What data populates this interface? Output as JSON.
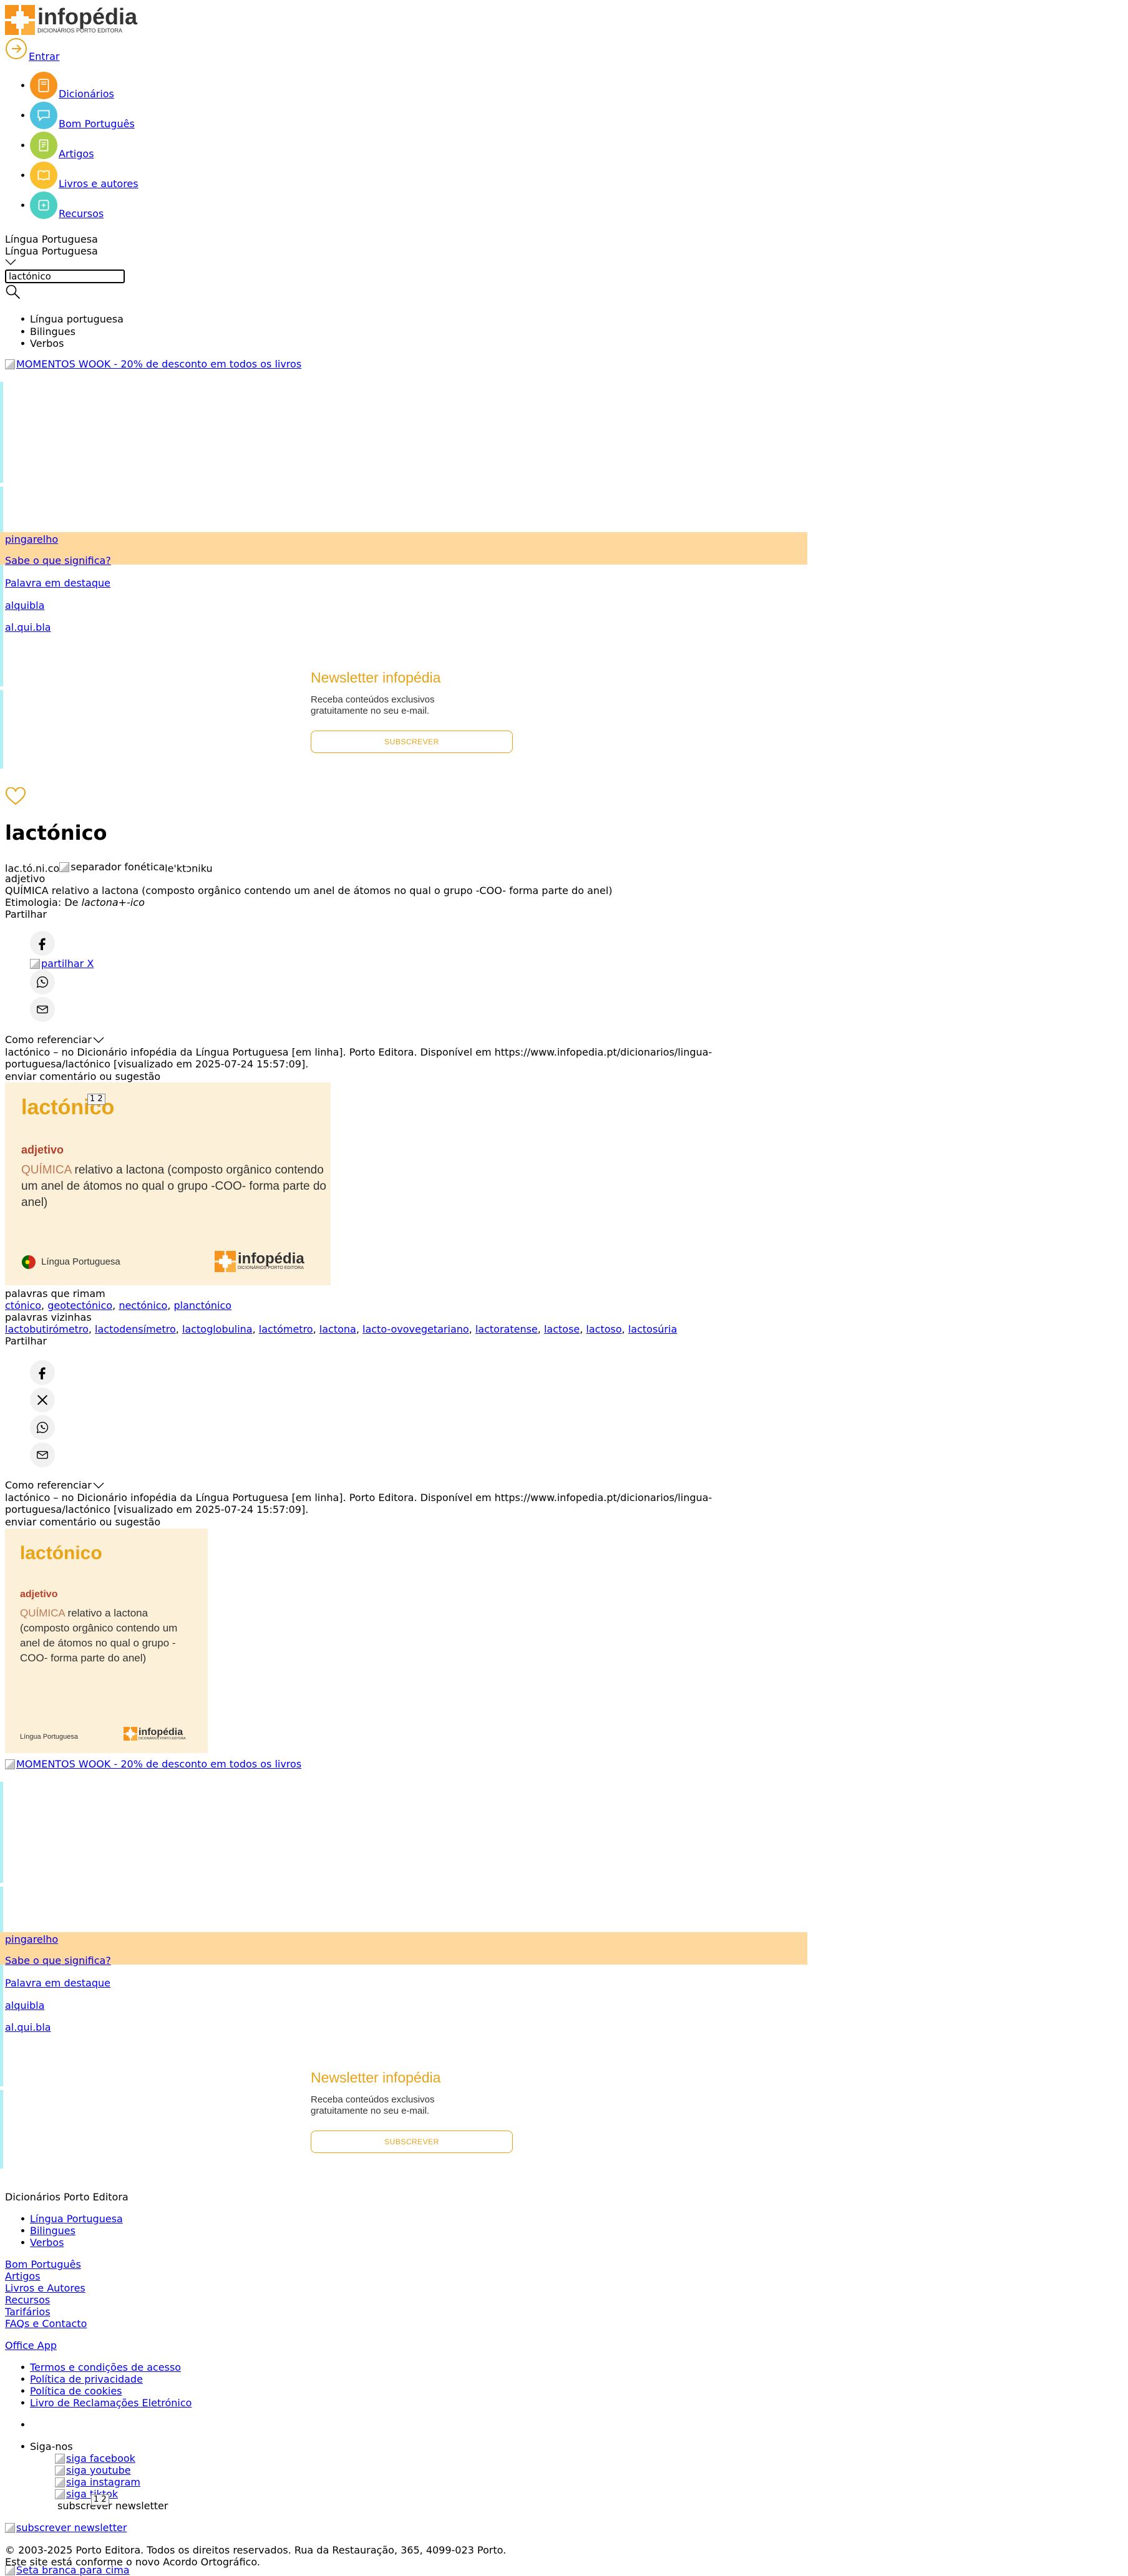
{
  "header": {
    "logo_text": "infopédia",
    "logo_subtext": "DICIONÁRIOS PORTO EDITORA",
    "login_label": "Entrar"
  },
  "nav": {
    "items": [
      {
        "label": "Dicionários",
        "color": "#f7941d"
      },
      {
        "label": "Bom Português",
        "color": "#4ec3e0"
      },
      {
        "label": "Artigos",
        "color": "#a9cf46"
      },
      {
        "label": "Livros e autores",
        "color": "#fbc02d"
      },
      {
        "label": "Recursos",
        "color": "#4dd0c4"
      }
    ]
  },
  "search": {
    "dictionary_selected": "Língua Portuguesa",
    "dictionary_selected_repeat": "Língua Portuguesa",
    "query": "lactónico",
    "options": [
      "Língua portuguesa",
      "Bilingues",
      "Verbos"
    ]
  },
  "ad": {
    "alt": "MOMENTOS WOOK - 20% de desconto em todos os livros"
  },
  "sidebar": {
    "featured_word": "pingarelho",
    "sabe_label": "Sabe o que significa?",
    "destaque_label": "Palavra em destaque",
    "destaque_word": "alquibla",
    "destaque_syllables": "al.qui.bla"
  },
  "newsletter": {
    "title": "Newsletter infopédia",
    "line1": "Receba conteúdos exclusivos",
    "line2": "gratuitamente no seu e-mail.",
    "button": "SUBSCREVER"
  },
  "entry": {
    "word": "lactónico",
    "syllables": "lac.tó.ni.co",
    "separator_alt": "separador fonética",
    "phonetic": "le'ktɔniku",
    "pos": "adjetivo",
    "domain": "QUÍMICA",
    "definition": "relativo a lactona (composto orgânico contendo um anel de átomos no qual o grupo -COO- forma parte do anel)",
    "etym_label": "Etimologia: De",
    "etym_word": "lactona",
    "etym_suffix": "+-ico",
    "share_label": "Partilhar",
    "share_x_alt": "partilhar X",
    "cite_label": "Como referenciar",
    "citation": "lactónico – no Dicionário infopédia da Língua Portuguesa [em linha]. Porto Editora. Disponível em https://www.infopedia.pt/dicionarios/lingua-portuguesa/lactónico [visualizado em 2025-07-24 15:57:09].",
    "comment_label": "enviar comentário ou sugestão"
  },
  "card": {
    "word": "lactónico",
    "pos": "adjetivo",
    "domain": "QUÍMICA",
    "definition": "relativo a lactona (composto orgânico contendo um anel de átomos no qual o grupo -COO- forma parte do anel)",
    "language": "Língua Portuguesa",
    "brand": "infopédia",
    "brand_sub": "DICIONÁRIOS PORTO EDITORA",
    "pager": "1 2"
  },
  "rimam": {
    "label": "palavras que rimam",
    "words": [
      "ctónico",
      "geotectónico",
      "nectónico",
      "planctónico"
    ]
  },
  "vizinhas": {
    "label": "palavras vizinhas",
    "words": [
      "lactobutirómetro",
      "lactodensímetro",
      "lactoglobulina",
      "lactómetro",
      "lactona",
      "lacto-ovovegetariano",
      "lactoratense",
      "lactose",
      "lactoso",
      "lactosúria"
    ]
  },
  "footer": {
    "title": "Dicionários Porto Editora",
    "dict_links": [
      "Língua Portuguesa",
      "Bilingues",
      "Verbos"
    ],
    "main_links": [
      "Bom Português",
      "Artigos",
      "Livros e Autores",
      "Recursos",
      "Tarifários",
      "FAQs e Contacto"
    ],
    "office_app": "Office App",
    "legal_links": [
      "Termos e condições de acesso",
      "Política de privacidade",
      "Política de cookies",
      "Livro de Reclamações Eletrónico"
    ],
    "follow_label": "Siga-nos",
    "social": [
      "siga facebook",
      "siga youtube",
      "siga instagram",
      "siga tiktok"
    ],
    "newsletter_item": "subscrever newsletter",
    "pager": "1 2",
    "newsletter_link": "subscrever newsletter",
    "copyright": "© 2003-2025 Porto Editora. Todos os direitos reservados. Rua da Restauração, 365, 4099-023 Porto.",
    "ao_note": "Este site está conforme o novo Acordo Ortográfico.",
    "back_top_alt": "Seta branca para cima"
  }
}
